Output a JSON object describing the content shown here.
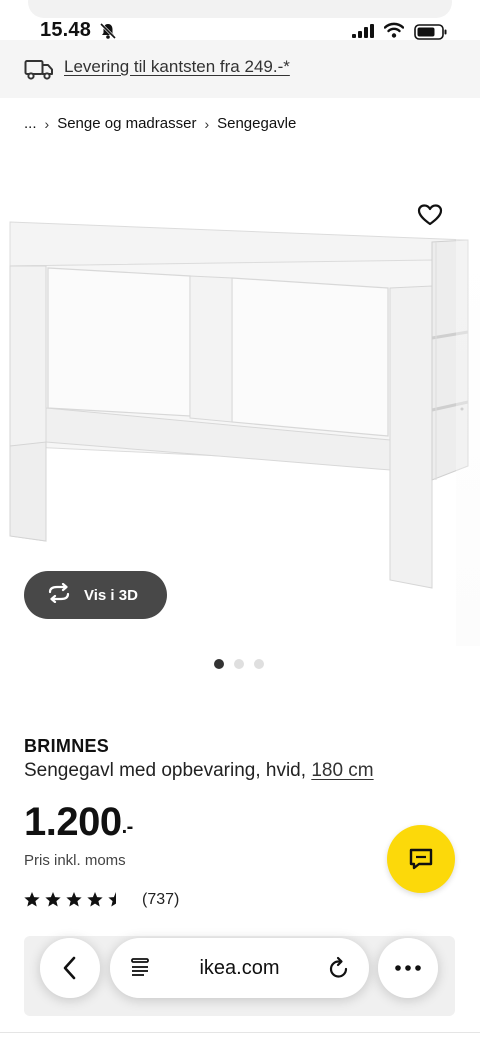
{
  "status_bar": {
    "time": "15.48"
  },
  "delivery_banner": {
    "text": "Levering til kantsten fra 249.-*"
  },
  "breadcrumb": {
    "items": [
      "...",
      "Senge og madrasser",
      "Sengegavle"
    ]
  },
  "product_image": {
    "vis3d_label": "Vis i 3D"
  },
  "carousel": {
    "count": 3,
    "active_index": 0
  },
  "product": {
    "name": "BRIMNES",
    "description": "Sengegavl med opbevaring, hvid,",
    "size_link": "180 cm",
    "price": "1.200",
    "price_suffix": ".-",
    "price_note": "Pris inkl. moms",
    "rating_value": 4.5,
    "rating_max": 5,
    "review_count": "(737)"
  },
  "browser": {
    "url": "ikea.com"
  },
  "colors": {
    "accent_yellow": "#fcd90a",
    "button_dark": "#484848",
    "banner_bg": "#f5f5f5"
  }
}
